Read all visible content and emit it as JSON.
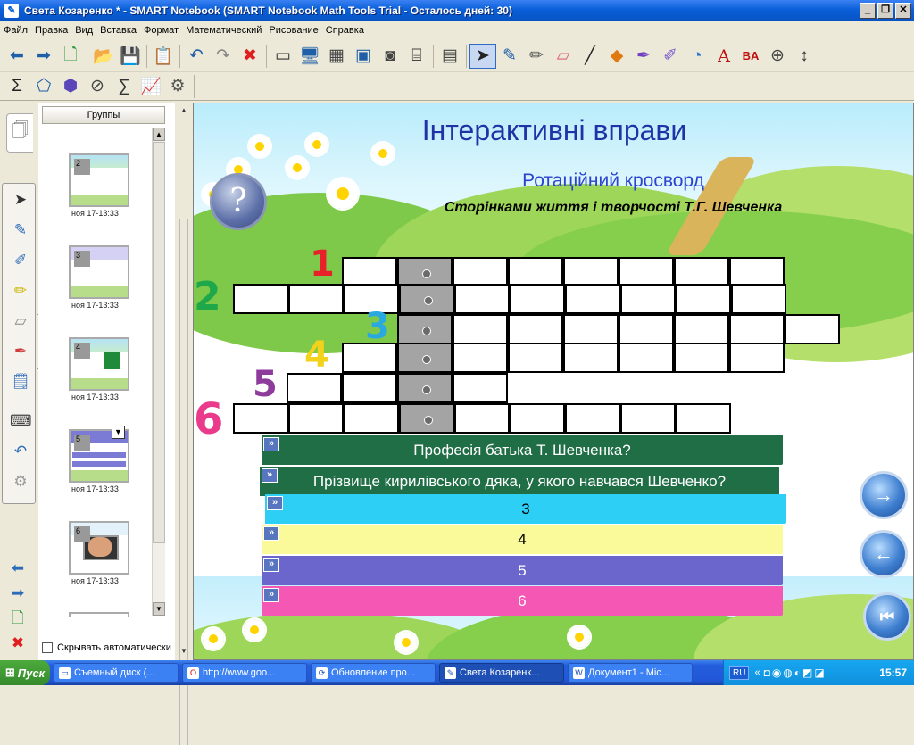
{
  "window": {
    "title": "Света Козаренко * - SMART Notebook (SMART Notebook Math Tools Trial - Осталось дней: 30)",
    "minimize": "_",
    "maximize": "❐",
    "close": "✕"
  },
  "menu": [
    "Файл",
    "Правка",
    "Вид",
    "Вставка",
    "Формат",
    "Математический",
    "Рисование",
    "Справка"
  ],
  "toolbar": {
    "row1": [
      "arrow-left-icon",
      "arrow-right-icon",
      "add-page-icon",
      "open-folder-icon",
      "save-icon",
      "paste-icon",
      "undo-icon",
      "redo-icon",
      "delete-icon",
      "screen-shade-icon",
      "fullscreen-icon",
      "transparent-background-icon",
      "dual-page-icon",
      "document-camera-icon",
      "capture-toolbar-icon",
      "table-icon",
      "select-icon",
      "pen-icon",
      "creative-pen-icon",
      "eraser-icon",
      "line-icon",
      "shapes-icon",
      "magic-pen-icon",
      "highlighter-icon",
      "fill-icon",
      "text-icon",
      "properties-icon",
      "math-tools-icon",
      "toolbar-move-icon"
    ],
    "row2": [
      "sigma-icon",
      "shape-recognition-icon",
      "polygon-icon",
      "compass-icon",
      "equation-icon",
      "graph-icon",
      "add-ins-icon"
    ]
  },
  "sorter": {
    "groups_label": "Группы",
    "pages": [
      {
        "num": "2",
        "caption": "ноя 17-13:33"
      },
      {
        "num": "3",
        "caption": "ноя 17-13:33"
      },
      {
        "num": "4",
        "caption": "ноя 17-13:33"
      },
      {
        "num": "5",
        "caption": "ноя 17-13:33"
      },
      {
        "num": "6",
        "caption": "ноя 17-13:33"
      }
    ],
    "autohide_label": "Скрывать автоматически"
  },
  "slide": {
    "title": "Інтерактивні вправи",
    "subtitle": "Ротаційний кросворд",
    "topic": "Сторінками життя і творчості Т.Г. Шевченка",
    "help_symbol": "?",
    "row_numbers": [
      "1",
      "2",
      "3",
      "4",
      "5",
      "6"
    ],
    "row_number_colors": [
      "#e8202a",
      "#1fa84a",
      "#2aa9e0",
      "#f2d21a",
      "#8e3c9c",
      "#ea3a8c"
    ],
    "questions": [
      {
        "text": "Професія батька Т. Шевченка?",
        "color": "#1f6e45",
        "text_color": "#ffffff"
      },
      {
        "text": "Прізвище кирилівського дяка, у якого навчався Шевченко?",
        "color": "#1f6e45",
        "text_color": "#ffffff"
      },
      {
        "text": "3",
        "color": "#2ecff4",
        "text_color": "#000000"
      },
      {
        "text": "4",
        "color": "#fafa9a",
        "text_color": "#000000"
      },
      {
        "text": "5",
        "color": "#6a66cc",
        "text_color": "#ffffff"
      },
      {
        "text": "6",
        "color": "#f457b4",
        "text_color": "#ffffff"
      }
    ],
    "nav": {
      "next": "→",
      "prev": "←",
      "first": "⏮"
    }
  },
  "taskbar": {
    "start_label": "Пуск",
    "tasks": [
      {
        "label": "Съемный диск (...",
        "icon": "folder-icon"
      },
      {
        "label": "http://www.goo...",
        "icon": "opera-icon"
      },
      {
        "label": "Обновление про...",
        "icon": "update-icon"
      },
      {
        "label": "Света Козаренк...",
        "icon": "smart-notebook-icon",
        "active": true
      },
      {
        "label": "Документ1 - Mic...",
        "icon": "word-icon"
      }
    ],
    "lang": "RU",
    "clock": "15:57"
  }
}
